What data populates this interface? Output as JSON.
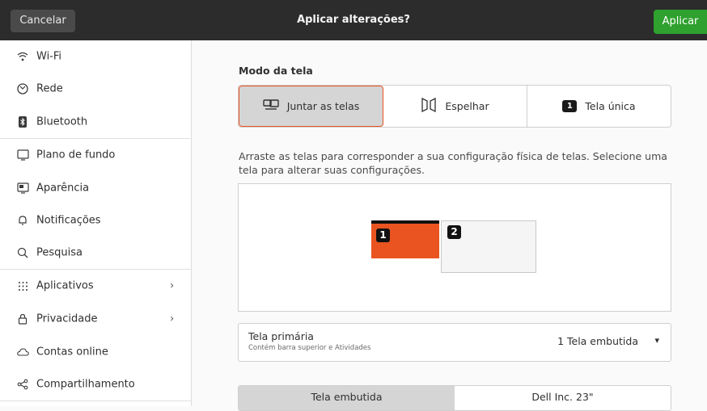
{
  "header": {
    "cancel_label": "Cancelar",
    "title": "Aplicar alterações?",
    "apply_label": "Aplicar"
  },
  "sidebar": {
    "items": [
      {
        "label": "Wi-Fi",
        "icon": "wifi-icon"
      },
      {
        "label": "Rede",
        "icon": "network-icon"
      },
      {
        "label": "Bluetooth",
        "icon": "bluetooth-icon"
      },
      {
        "label": "Plano de fundo",
        "icon": "background-icon"
      },
      {
        "label": "Aparência",
        "icon": "appearance-icon"
      },
      {
        "label": "Notificações",
        "icon": "bell-icon"
      },
      {
        "label": "Pesquisa",
        "icon": "search-icon"
      },
      {
        "label": "Aplicativos",
        "icon": "apps-grid-icon",
        "chevron": "›"
      },
      {
        "label": "Privacidade",
        "icon": "lock-icon",
        "chevron": "›"
      },
      {
        "label": "Contas online",
        "icon": "cloud-icon"
      },
      {
        "label": "Compartilhamento",
        "icon": "share-icon"
      }
    ]
  },
  "display": {
    "mode_label": "Modo da tela",
    "modes": [
      {
        "label": "Juntar as telas",
        "icon": "join-displays-icon",
        "active": true
      },
      {
        "label": "Espelhar",
        "icon": "mirror-icon",
        "active": false
      },
      {
        "label": "Tela única",
        "icon": "single-display-icon",
        "active": false
      }
    ],
    "hint": "Arraste as telas para corresponder a sua configuração física de telas. Selecione uma tela para alterar suas configurações.",
    "monitors": [
      {
        "number": "1",
        "color": "#e95420"
      },
      {
        "number": "2",
        "color": "#f5f5f5"
      }
    ],
    "single_badge": "1",
    "primary": {
      "title": "Tela primária",
      "subtitle": "Contém barra superior e Atividades",
      "value": "1  Tela embutida",
      "caret": "▾"
    },
    "tabs": [
      {
        "label": "Tela embutida",
        "active": true
      },
      {
        "label": "Dell Inc. 23\"",
        "active": false
      }
    ]
  },
  "colors": {
    "accent": "#e95420",
    "apply": "#2ea12e",
    "header": "#2c2c2c"
  }
}
